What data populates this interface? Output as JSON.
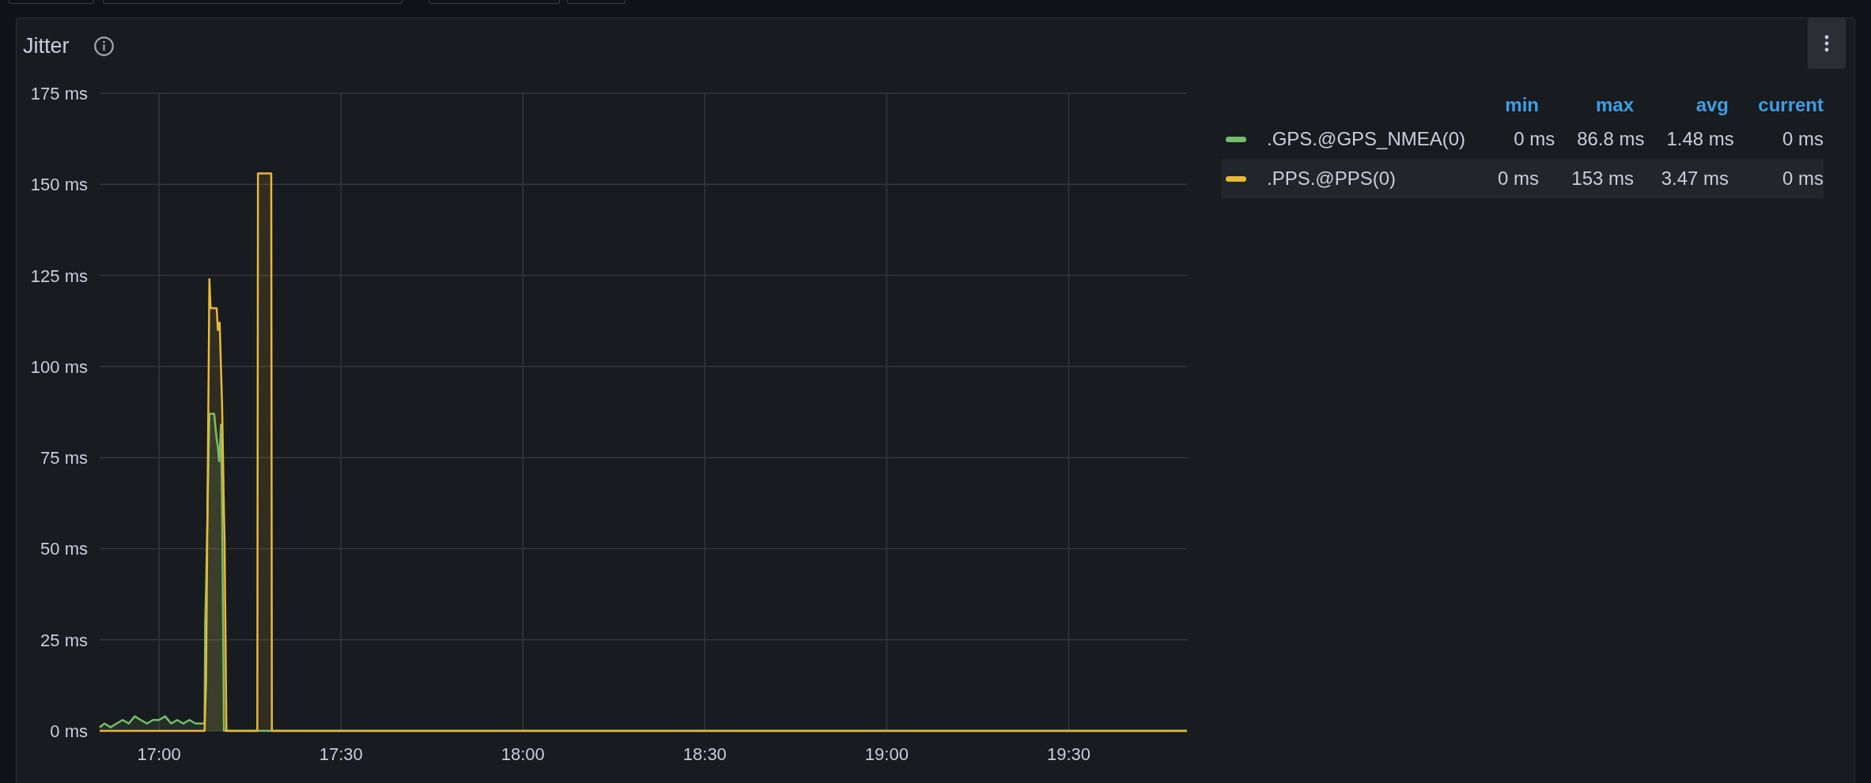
{
  "panel": {
    "title": "Jitter",
    "chart_data": {
      "type": "line",
      "grid": true,
      "xlim": [
        16.8367,
        19.825
      ],
      "ylim": [
        0,
        175
      ],
      "x": [
        16.8367,
        16.85,
        16.8667,
        16.8833,
        16.9,
        16.9167,
        16.9333,
        16.95,
        16.9667,
        16.9833,
        17,
        17.0167,
        17.0333,
        17.05,
        17.0667,
        17.0833,
        17.1,
        17.1167,
        17.125,
        17.1267,
        17.1292,
        17.1383,
        17.1417,
        17.1517,
        17.1583,
        17.1617,
        17.165,
        17.1667,
        17.17,
        17.1733,
        17.1783,
        17.18,
        17.185,
        17.27,
        17.2717,
        17.3083,
        17.31,
        19.825
      ],
      "series": [
        {
          "name": ".GPS.@GPS_NMEA(0)",
          "color": "#73bf69",
          "values": [
            1,
            2,
            1,
            2,
            3,
            2,
            4,
            3,
            2,
            3,
            3,
            4,
            2,
            3,
            2,
            3,
            2,
            2,
            2,
            30,
            40,
            87,
            87,
            87,
            80,
            78,
            74,
            76,
            84,
            60,
            0,
            0,
            0,
            0,
            0,
            0,
            0,
            0
          ]
        },
        {
          "name": ".PPS.@PPS(0)",
          "color": "#eab839",
          "values": [
            0,
            0,
            0,
            0,
            0,
            0,
            0,
            0,
            0,
            0,
            0,
            0,
            0,
            0,
            0,
            0,
            0,
            0,
            0,
            5,
            14,
            124,
            116,
            116,
            116,
            110,
            112,
            112,
            100,
            89,
            60,
            52,
            0,
            0,
            153,
            153,
            0,
            0
          ]
        }
      ],
      "yticks": [
        {
          "value": 0,
          "label": "0 ms"
        },
        {
          "value": 25,
          "label": "25 ms"
        },
        {
          "value": 50,
          "label": "50 ms"
        },
        {
          "value": 75,
          "label": "75 ms"
        },
        {
          "value": 100,
          "label": "100 ms"
        },
        {
          "value": 125,
          "label": "125 ms"
        },
        {
          "value": 150,
          "label": "150 ms"
        },
        {
          "value": 175,
          "label": "175 ms"
        }
      ],
      "xticks": [
        {
          "value": 17,
          "label": "17:00"
        },
        {
          "value": 17.5,
          "label": "17:30"
        },
        {
          "value": 18,
          "label": "18:00"
        },
        {
          "value": 18.5,
          "label": "18:30"
        },
        {
          "value": 19,
          "label": "19:00"
        },
        {
          "value": 19.5,
          "label": "19:30"
        }
      ]
    },
    "legend": {
      "columns": [
        "min",
        "max",
        "avg",
        "current"
      ],
      "rows": [
        {
          "highlighted": false,
          "values": [
            "0 ms",
            "86.8 ms",
            "1.48 ms",
            "0 ms"
          ]
        },
        {
          "highlighted": true,
          "values": [
            "0 ms",
            "153 ms",
            "3.47 ms",
            "0 ms"
          ]
        }
      ]
    }
  }
}
